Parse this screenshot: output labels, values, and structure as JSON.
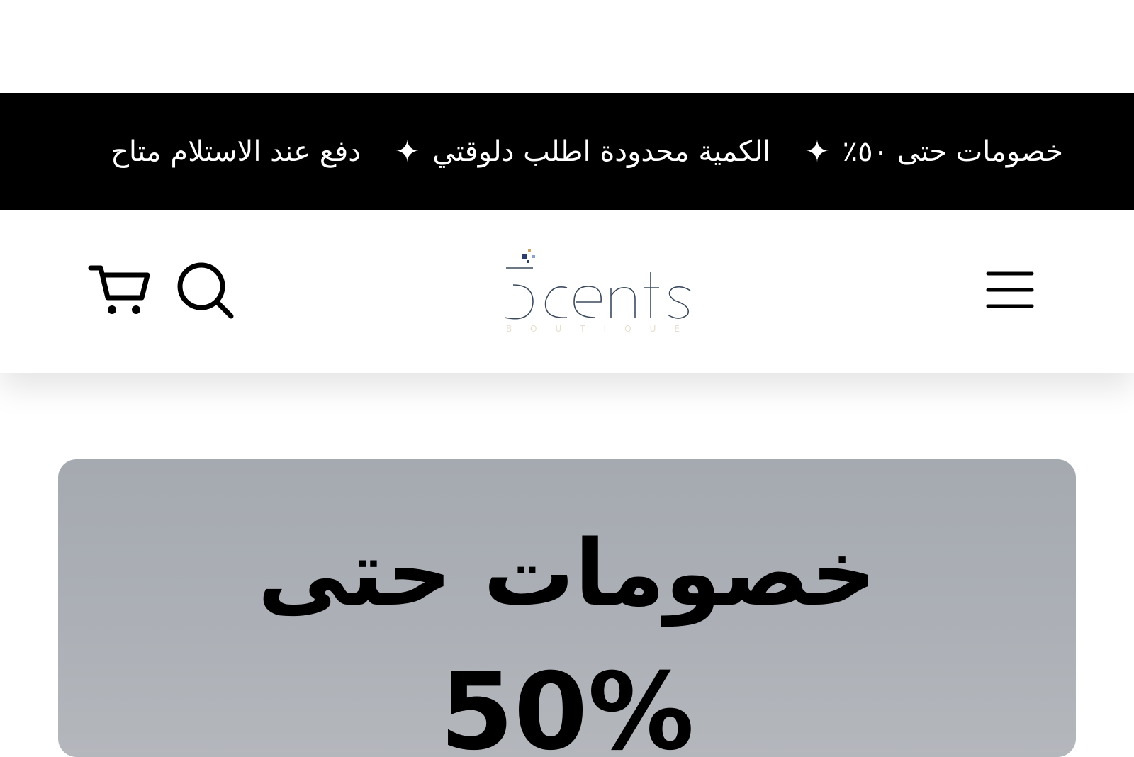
{
  "announcement_bar": {
    "messages": [
      "دفع عند الاستلام متاح",
      "الكمية محدودة اطلب دلوقتي",
      "خصومات حتى ٥٠٪"
    ],
    "separator": "✦",
    "background": "#000000",
    "text_color": "#ffffff"
  },
  "header": {
    "logo": {
      "wordmark": "5cents",
      "tagline": "BOUTIQUE"
    },
    "icons": {
      "cart": "cart-icon",
      "search": "search-icon",
      "menu": "hamburger-menu-icon"
    }
  },
  "hero": {
    "title": "خصومات حتى",
    "percent": "50%",
    "background": "#a9adb3"
  }
}
